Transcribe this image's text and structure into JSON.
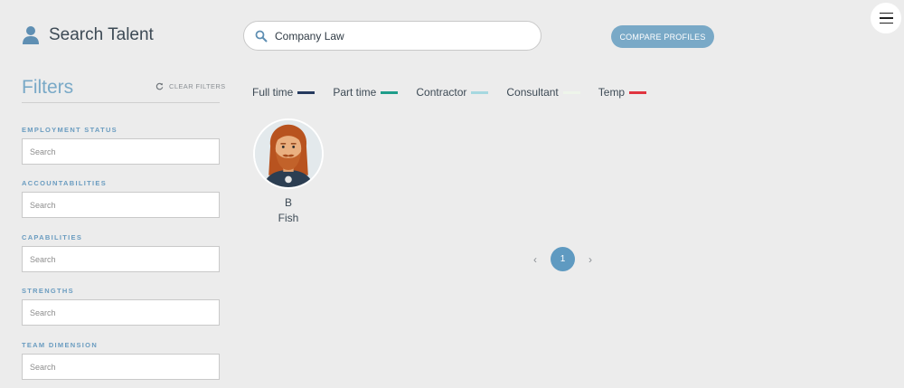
{
  "header": {
    "title": "Search Talent",
    "icon": "person-icon"
  },
  "search": {
    "value": "Company Law",
    "icon": "search-icon"
  },
  "compare_button": {
    "label": "COMPARE PROFILES"
  },
  "menu": {
    "icon": "hamburger-menu-icon"
  },
  "filters": {
    "title": "Filters",
    "clear_label": "CLEAR FILTERS",
    "groups": [
      {
        "label": "EMPLOYMENT STATUS",
        "placeholder": "Search"
      },
      {
        "label": "ACCOUNTABILITIES",
        "placeholder": "Search"
      },
      {
        "label": "CAPABILITIES",
        "placeholder": "Search"
      },
      {
        "label": "STRENGTHS",
        "placeholder": "Search"
      },
      {
        "label": "TEAM DIMENSION",
        "placeholder": "Search"
      }
    ]
  },
  "legend": [
    {
      "label": "Full time",
      "color": "#253a5e"
    },
    {
      "label": "Part time",
      "color": "#1f9d8a"
    },
    {
      "label": "Contractor",
      "color": "#a6d8e0"
    },
    {
      "label": "Consultant",
      "color": "#eef5ea"
    },
    {
      "label": "Temp",
      "color": "#e0353f"
    }
  ],
  "profiles": [
    {
      "first_name": "B",
      "last_name": "Fish",
      "avatar": "bearded-man-avatar"
    }
  ],
  "pagination": {
    "current_page": "1"
  },
  "colors": {
    "accent": "#79a9c7",
    "page_active": "#5f9ac1",
    "background": "#ececec"
  }
}
